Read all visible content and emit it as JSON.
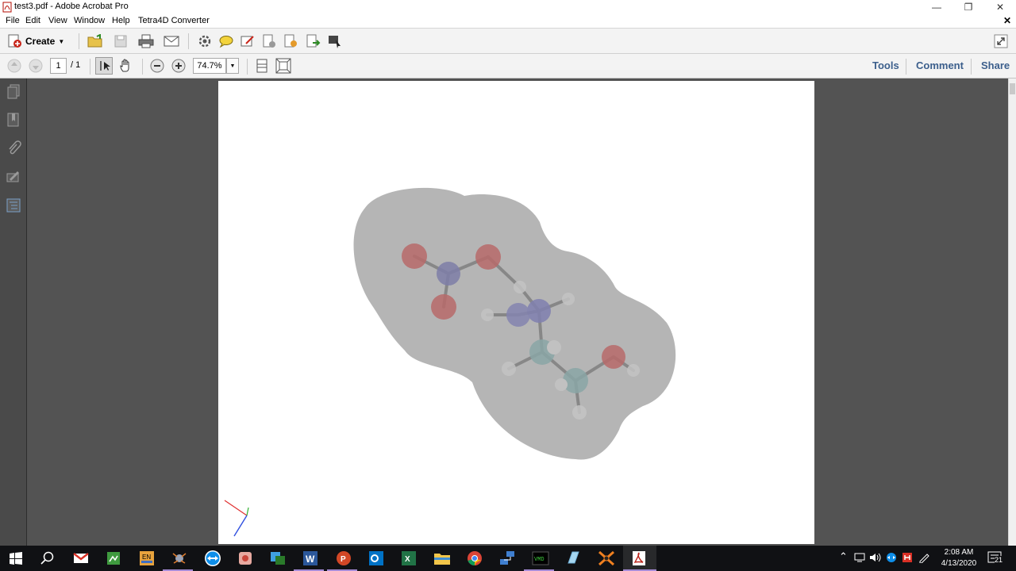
{
  "window": {
    "title": "test3.pdf - Adobe Acrobat Pro",
    "icons": {
      "minimize": "minimize-icon",
      "restore": "restore-icon",
      "close": "close-icon"
    }
  },
  "menubar": {
    "items": [
      "File",
      "Edit",
      "View",
      "Window",
      "Help",
      "Tetra4D Converter"
    ]
  },
  "toolbar": {
    "create_label": "Create",
    "icons": [
      "open-folder-icon",
      "save-icon",
      "print-icon",
      "email-icon",
      "settings-gear-icon",
      "comment-icon",
      "sign-icon",
      "delete-pages-icon",
      "export-icon",
      "insert-icon",
      "select-icon"
    ]
  },
  "navbar": {
    "page_current": "1",
    "page_total": "/ 1",
    "zoom": "74.7%",
    "tools_label": "Tools",
    "comment_label": "Comment",
    "share_label": "Share"
  },
  "left_panel": {
    "icons": [
      "page-thumbnails-icon",
      "bookmarks-icon",
      "attachments-icon",
      "signatures-icon",
      "layers-icon"
    ]
  },
  "document": {
    "content": "3d-molecule-model",
    "axis_widget": "axis-triad-icon"
  },
  "taskbar": {
    "apps": [
      "start-icon",
      "search-icon",
      "gmail-icon",
      "app-green-icon",
      "language-en-icon",
      "app-ant-icon",
      "teamviewer-icon",
      "chrome-app-icon",
      "app-blue-window-icon",
      "word-icon",
      "powerpoint-icon",
      "outlook-icon",
      "excel-icon",
      "file-explorer-icon",
      "chrome-icon",
      "network-app-icon",
      "terminal-icon",
      "app-crystal-icon",
      "app-x-icon",
      "acrobat-icon"
    ],
    "time": "2:08 AM",
    "date": "4/13/2020",
    "notification_count": "21",
    "colors": {
      "accent": "#a58bd6",
      "link": "#3c5f8c",
      "doc_bg": "#535353"
    }
  }
}
